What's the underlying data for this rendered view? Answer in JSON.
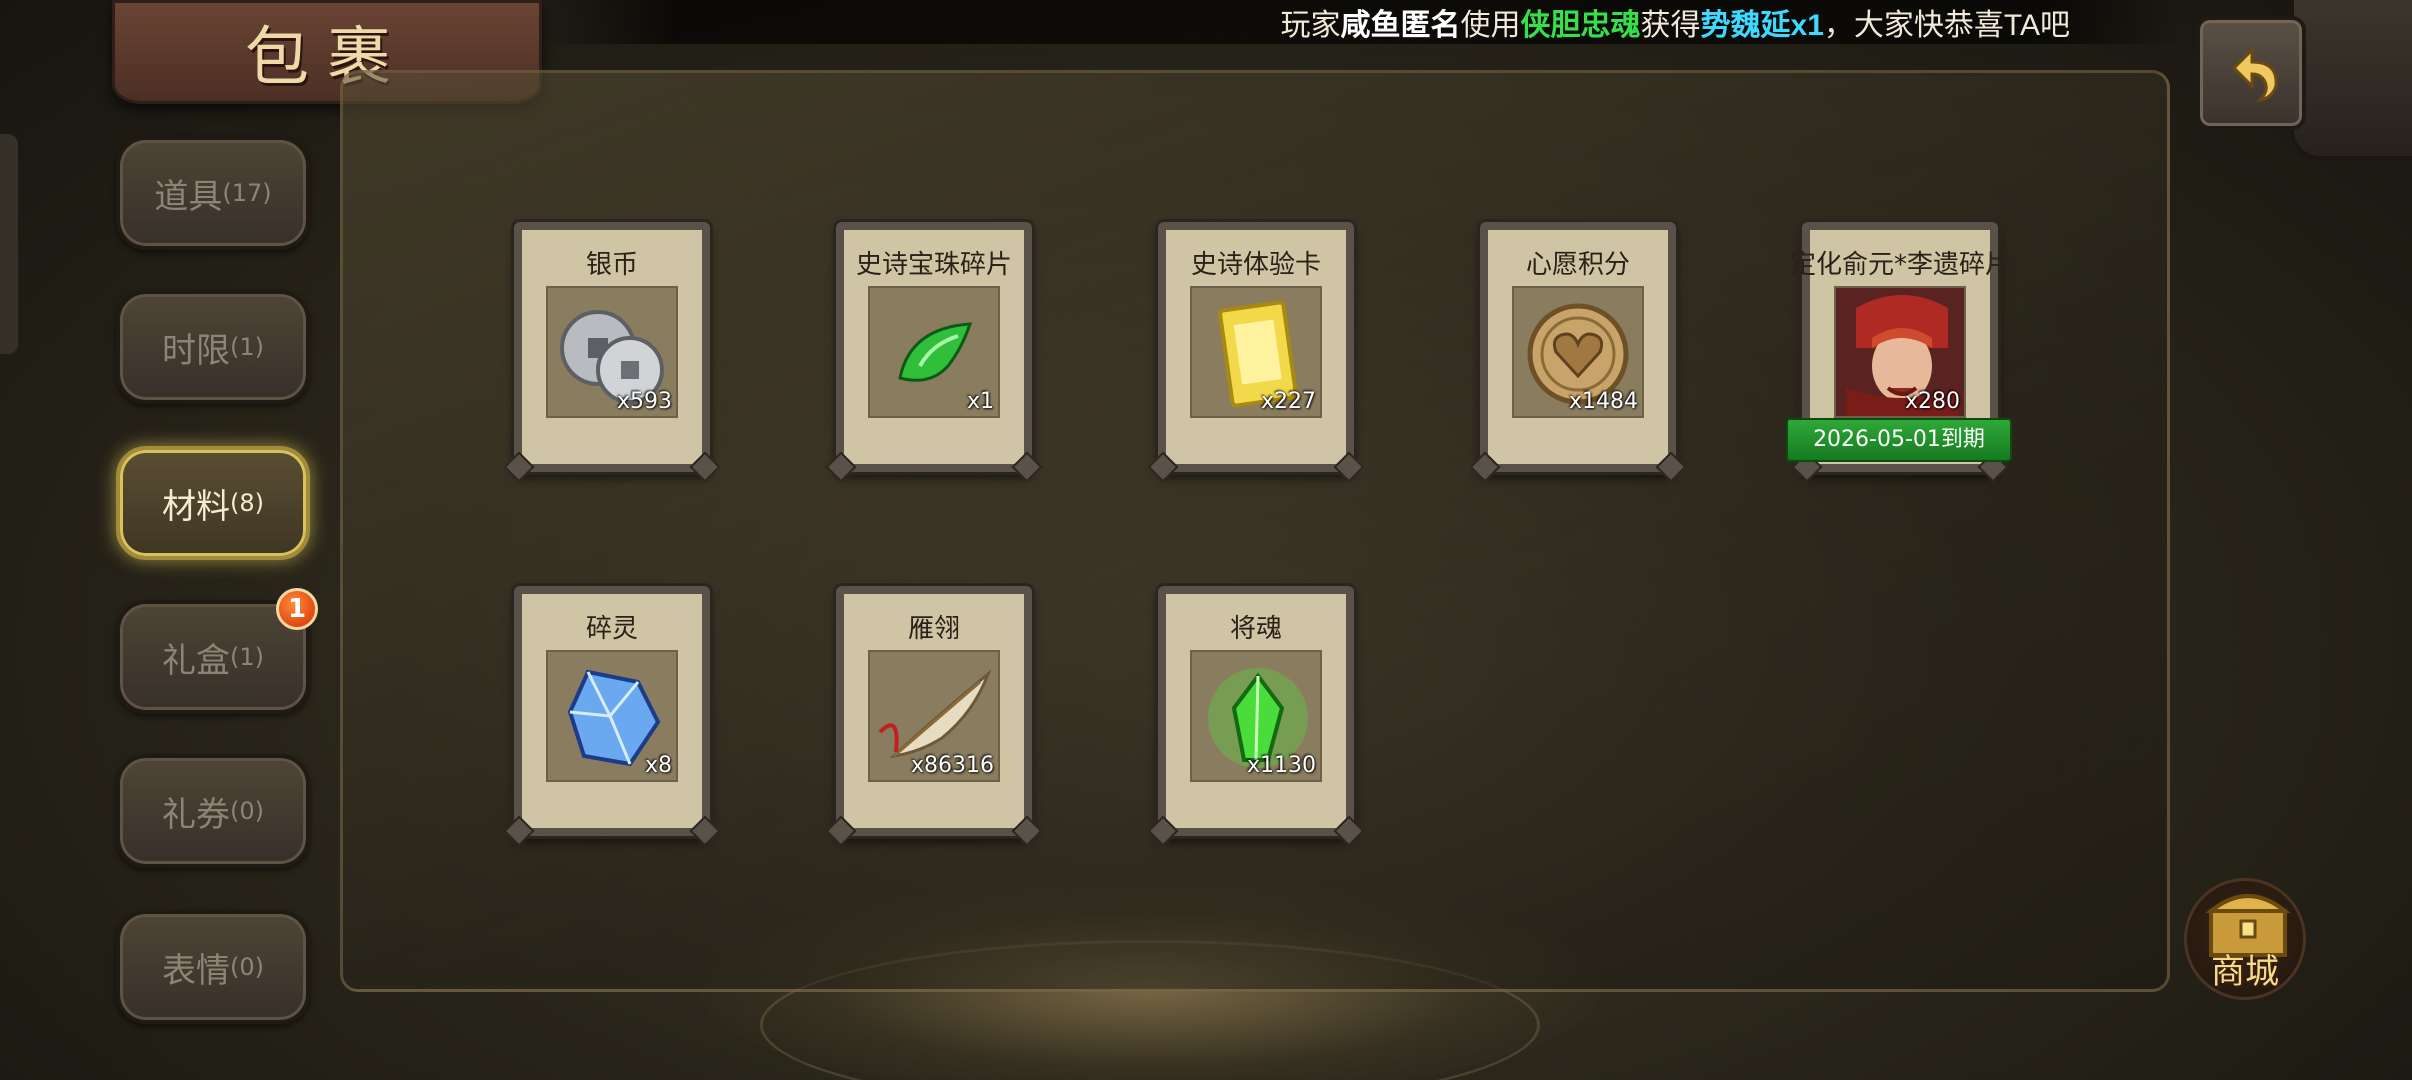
{
  "title": "包裹",
  "broadcast": {
    "prefix": "玩家",
    "player": "咸鱼匿名",
    "mid1": "使用",
    "item_used": "侠胆忠魂",
    "mid2": "获得",
    "reward": "势魏延x1",
    "suffix": "，大家快恭喜TA吧"
  },
  "tabs": [
    {
      "label": "道具",
      "count": "(17)",
      "active": false
    },
    {
      "label": "时限",
      "count": "(1)",
      "active": false
    },
    {
      "label": "材料",
      "count": "(8)",
      "active": true
    },
    {
      "label": "礼盒",
      "count": "(1)",
      "active": false,
      "badge": "1"
    },
    {
      "label": "礼券",
      "count": "(0)",
      "active": false
    },
    {
      "label": "表情",
      "count": "(0)",
      "active": false
    }
  ],
  "items": [
    {
      "name": "银币",
      "qty": "x593",
      "icon": "silver-coin-icon"
    },
    {
      "name": "史诗宝珠碎片",
      "qty": "x1",
      "icon": "green-gem-shard-icon"
    },
    {
      "name": "史诗体验卡",
      "qty": "x227",
      "icon": "gold-card-icon"
    },
    {
      "name": "心愿积分",
      "qty": "x1484",
      "icon": "heart-coin-icon"
    },
    {
      "name": "定化俞元*李遗碎片",
      "qty": "x280",
      "icon": "hero-portrait-icon",
      "expire": "2026-05-01到期"
    },
    {
      "name": "碎灵",
      "qty": "x8",
      "icon": "blue-crystal-icon"
    },
    {
      "name": "雁翎",
      "qty": "x86316",
      "icon": "feather-icon"
    },
    {
      "name": "将魂",
      "qty": "x1130",
      "icon": "green-soul-crystal-icon"
    }
  ],
  "buttons": {
    "back": "back-arrow-icon",
    "shop_label": "商城"
  },
  "colors": {
    "player_name": "#ffffff",
    "item_used": "#36e04a",
    "reward": "#3fd8ff",
    "expire_bg": "#1f9a2a",
    "active_tab_glow": "#d8c35a"
  }
}
